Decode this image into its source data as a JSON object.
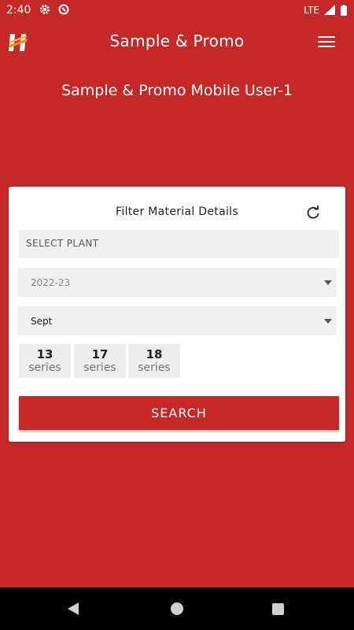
{
  "status_bar": {
    "time": "2:40",
    "network": "LTE"
  },
  "app_bar": {
    "title": "Sample & Promo"
  },
  "user_title": "Sample & Promo Mobile User-1",
  "filter": {
    "title": "Filter Material Details",
    "plant_placeholder": "SELECT PLANT",
    "year_value": "2022-23",
    "month_value": "Sept",
    "series": [
      {
        "number": "13",
        "label": "series"
      },
      {
        "number": "17",
        "label": "series"
      },
      {
        "number": "18",
        "label": "series"
      }
    ],
    "search_label": "SEARCH"
  },
  "colors": {
    "primary": "#c62828",
    "field_bg": "#f0f0f0",
    "nav_bg": "#000000"
  },
  "icons": [
    "gear-icon",
    "sync-icon",
    "signal-icon",
    "battery-icon",
    "app-logo-icon",
    "hamburger-menu-icon",
    "refresh-icon",
    "dropdown-arrow-icon",
    "back-icon",
    "home-icon",
    "recents-icon"
  ]
}
